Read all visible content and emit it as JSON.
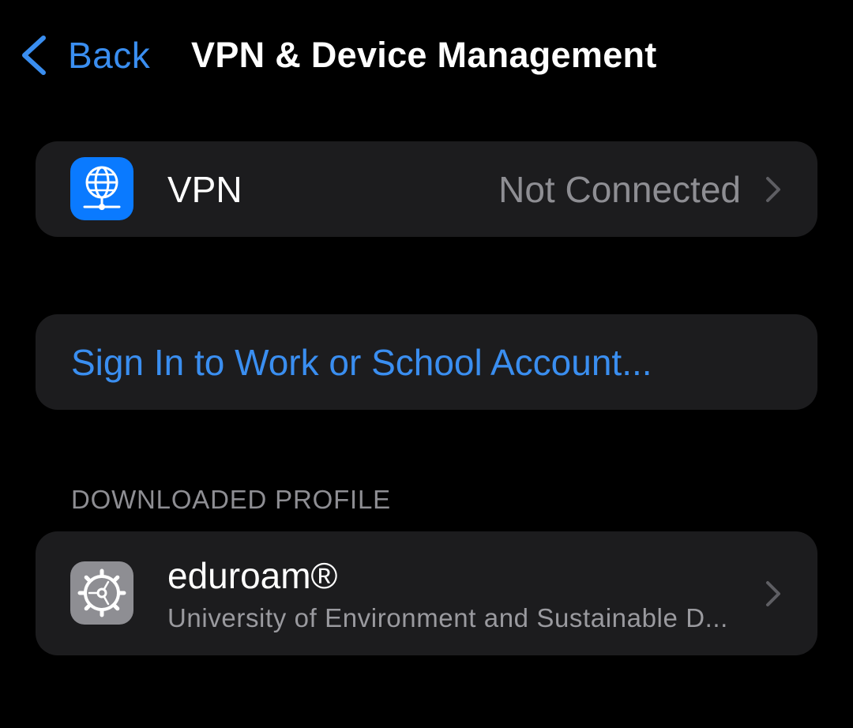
{
  "nav": {
    "back_label": "Back",
    "title": "VPN & Device Management"
  },
  "vpn_row": {
    "icon": "vpn-globe-icon",
    "label": "VPN",
    "status": "Not Connected"
  },
  "signin": {
    "label": "Sign In to Work or School Account..."
  },
  "downloaded_profile": {
    "header": "DOWNLOADED PROFILE",
    "items": [
      {
        "icon": "gear-icon",
        "name": "eduroam®",
        "organization": "University of Environment and Sustainable D..."
      }
    ]
  },
  "colors": {
    "background": "#000000",
    "cell": "#1c1c1e",
    "accent": "#3a8ef0",
    "vpn_icon_bg": "#0a7aff",
    "profile_icon_bg": "#8e8e93",
    "secondary_text": "#8e8e93"
  }
}
